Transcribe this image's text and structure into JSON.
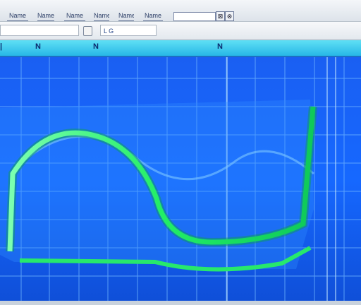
{
  "menubar": {
    "items": [
      {
        "label": "Name"
      },
      {
        "label": "Name"
      },
      {
        "label": "Name"
      },
      {
        "label": "Name"
      },
      {
        "label": "Name"
      },
      {
        "label": "Name"
      }
    ],
    "search_value": "",
    "window_buttons": [
      "⊠",
      "⊗"
    ]
  },
  "toolbar": {
    "field1_value": "",
    "field2_label": "L  G"
  },
  "ruler": {
    "markers": [
      "N",
      "N",
      "N"
    ]
  },
  "colors": {
    "plot_background": "#0f55e8",
    "grid": "#6fb0ff",
    "curve": "#22ee66",
    "ruler": "#33c3ee"
  }
}
